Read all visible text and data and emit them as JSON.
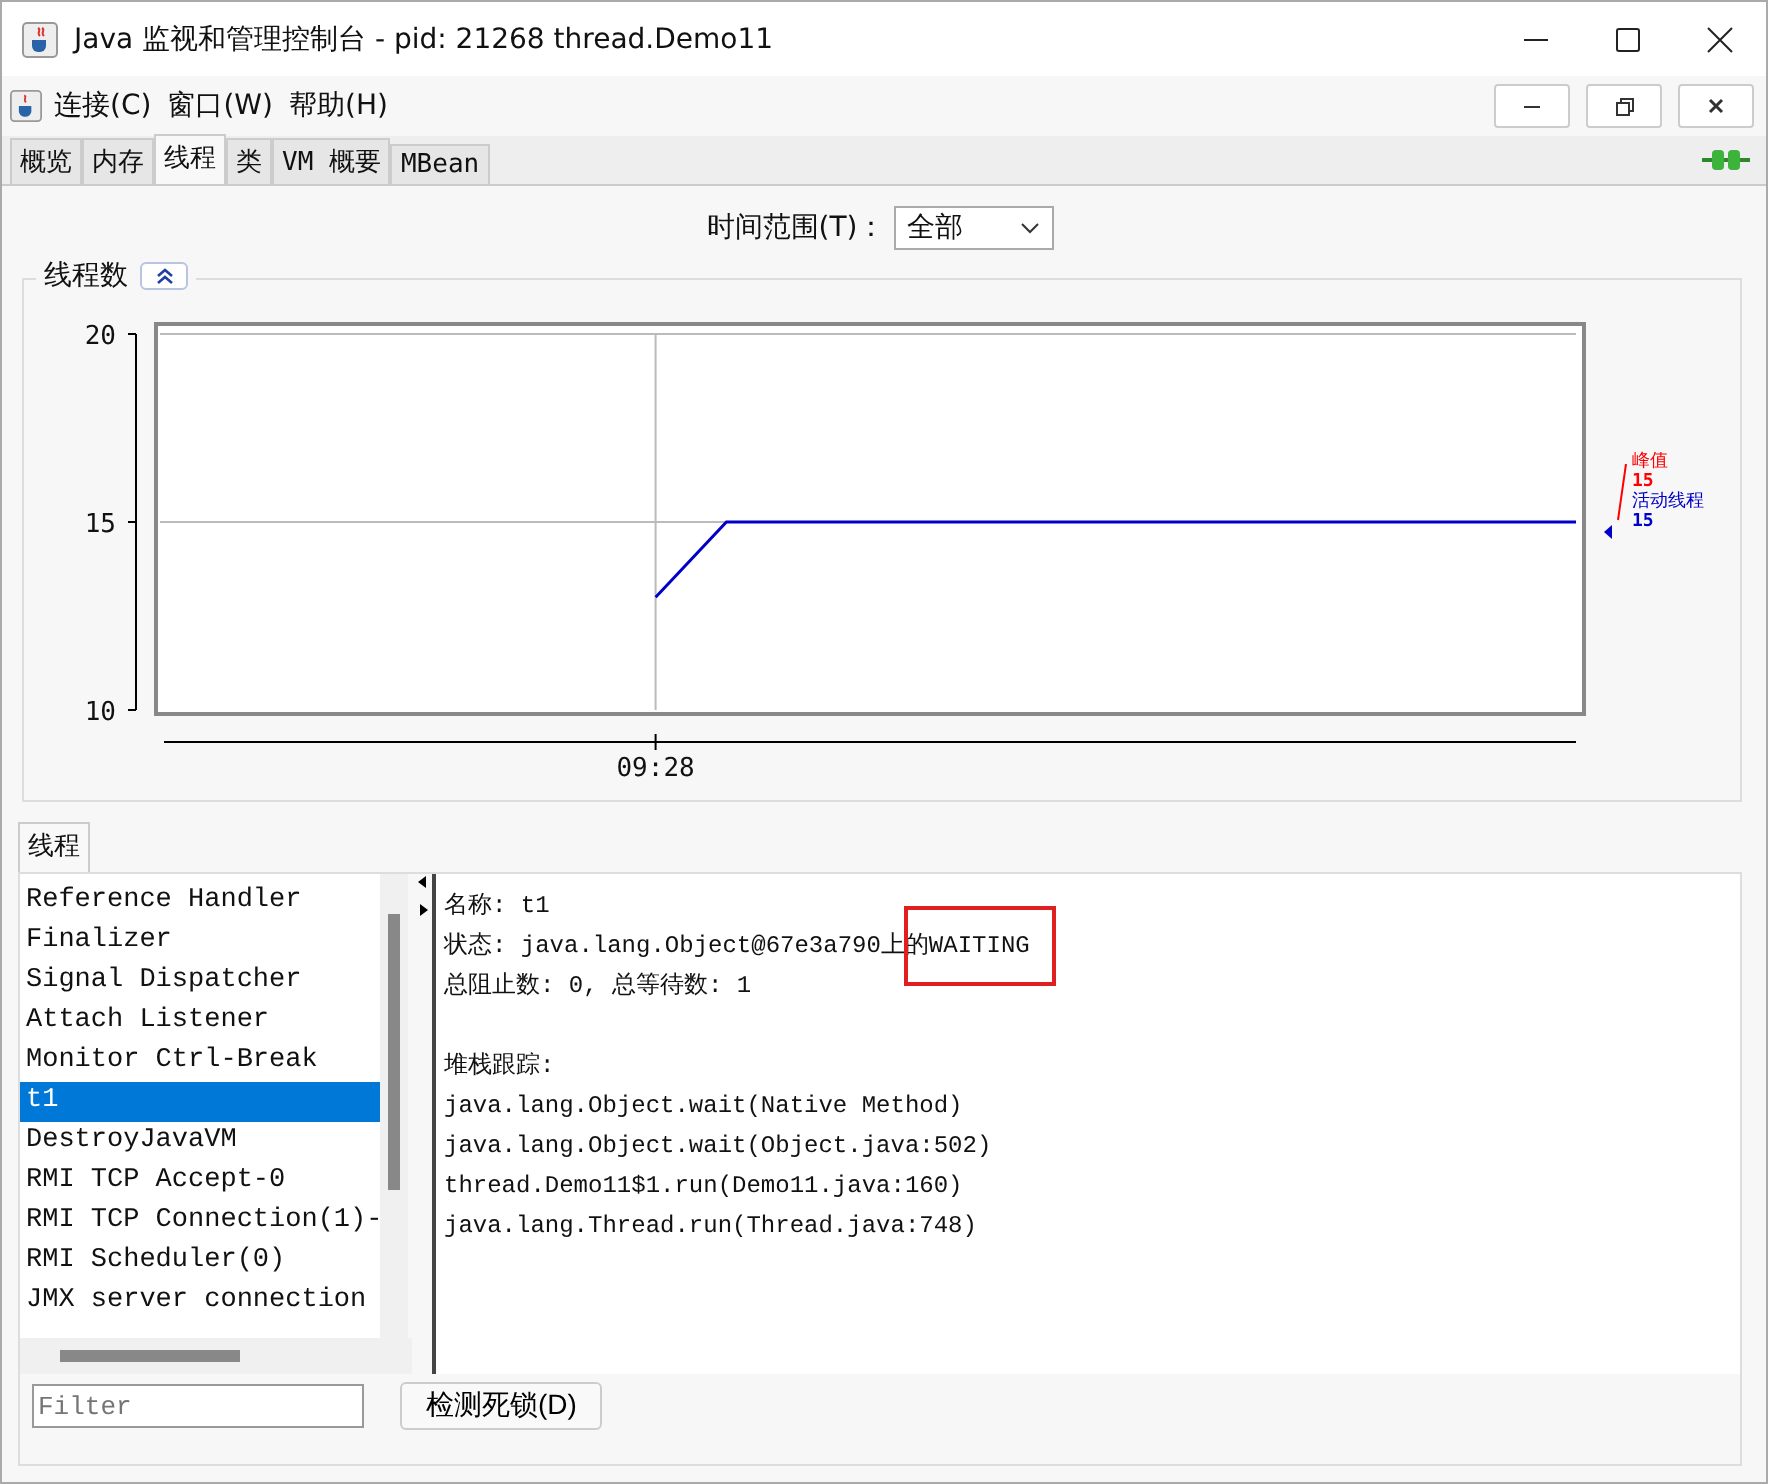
{
  "window": {
    "title": "Java 监视和管理控制台 - pid: 21268 thread.Demo11"
  },
  "menu": [
    "连接(C)",
    "窗口(W)",
    "帮助(H)"
  ],
  "tabs": [
    {
      "label": "概览",
      "selected": false
    },
    {
      "label": "内存",
      "selected": false
    },
    {
      "label": "线程",
      "selected": true
    },
    {
      "label": "类",
      "selected": false
    },
    {
      "label": "VM 概要",
      "selected": false
    },
    {
      "label": "MBean",
      "selected": false
    }
  ],
  "time_range": {
    "label": "时间范围(T)：",
    "value": "全部"
  },
  "chart_panel": {
    "title": "线程数",
    "chart_data": {
      "type": "line",
      "categories": [
        null,
        null,
        null,
        null,
        null,
        null,
        null,
        "09:28",
        null,
        null,
        null,
        null,
        null,
        null,
        null,
        null,
        null,
        null,
        null,
        null,
        null
      ],
      "ylim": [
        10,
        20
      ],
      "yticks": [
        10,
        15,
        20
      ],
      "series": [
        {
          "name": "活动线程",
          "color": "#0000c8",
          "values": [
            null,
            null,
            null,
            null,
            null,
            null,
            null,
            13,
            15,
            15,
            15,
            15,
            15,
            15,
            15,
            15,
            15,
            15,
            15,
            15,
            15
          ]
        }
      ]
    },
    "peak": {
      "name": "峰值",
      "value": "15",
      "color": "#ff0000"
    },
    "series_values": [
      "15"
    ]
  },
  "threads_tab": "线程",
  "threads": [
    {
      "name": "Reference Handler",
      "selected": false
    },
    {
      "name": "Finalizer",
      "selected": false
    },
    {
      "name": "Signal Dispatcher",
      "selected": false
    },
    {
      "name": "Attach Listener",
      "selected": false
    },
    {
      "name": "Monitor Ctrl-Break",
      "selected": false
    },
    {
      "name": "t1",
      "selected": true
    },
    {
      "name": "DestroyJavaVM",
      "selected": false
    },
    {
      "name": "RMI TCP Accept-0",
      "selected": false
    },
    {
      "name": "RMI TCP Connection(1)-",
      "selected": false
    },
    {
      "name": "RMI Scheduler(0)",
      "selected": false
    },
    {
      "name": "JMX server connection",
      "selected": false
    }
  ],
  "details": {
    "info": [
      "名称: t1",
      "状态: java.lang.Object@67e3a790上的WAITING",
      "总阻止数: 0, 总等待数: 1"
    ],
    "stack_title": "堆栈跟踪:",
    "stack": [
      "java.lang.Object.wait(Native Method)",
      "java.lang.Object.wait(Object.java:502)",
      "thread.Demo11$1.run(Demo11.java:160)",
      "java.lang.Thread.run(Thread.java:748)"
    ]
  },
  "filter": {
    "placeholder": "Filter"
  },
  "deadlock_button": "检测死锁(D)"
}
